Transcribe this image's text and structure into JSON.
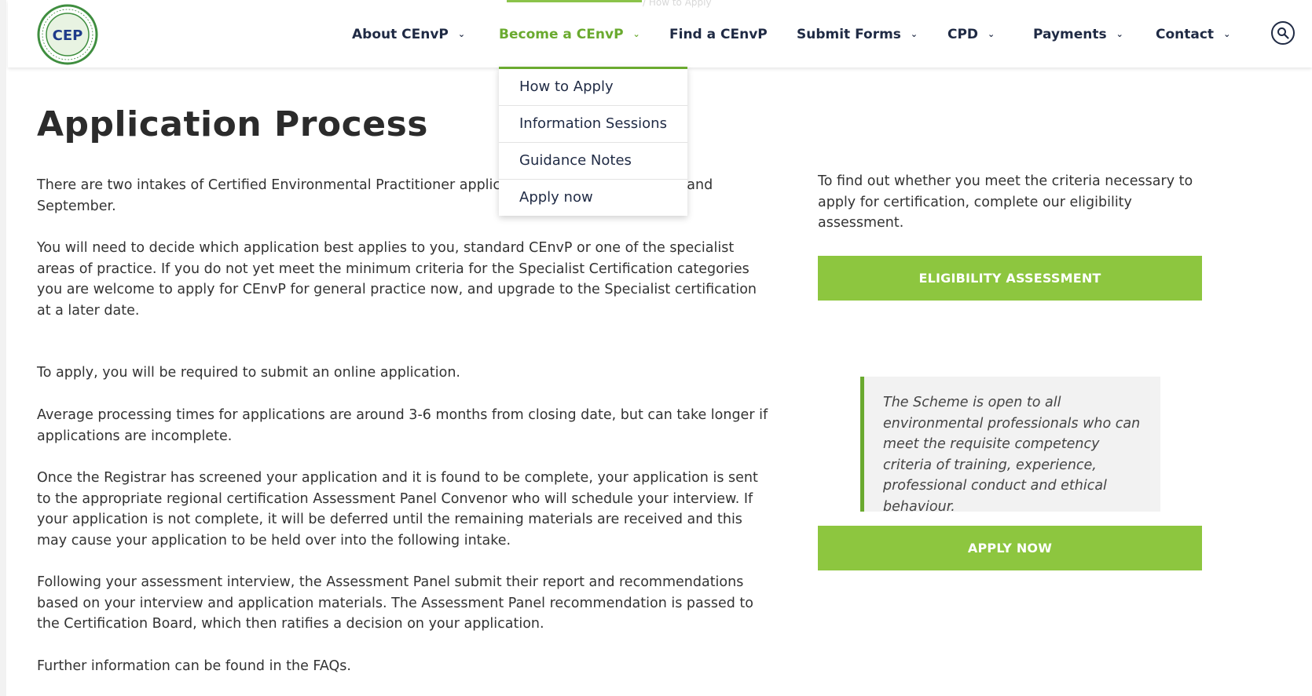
{
  "nav": {
    "items": [
      {
        "label": "About CEnvP",
        "chevron": true
      },
      {
        "label": "Become a CEnvP",
        "chevron": true,
        "active": true
      },
      {
        "label": "Find a CEnvP",
        "chevron": false
      },
      {
        "label": "Submit Forms",
        "chevron": true
      },
      {
        "label": "CPD",
        "chevron": true
      },
      {
        "label": "Payments",
        "chevron": true
      },
      {
        "label": "Contact",
        "chevron": true
      }
    ],
    "faint_breadcrumb": "/ How to Apply"
  },
  "logo": {
    "initials": "CEP",
    "ring_text": "CERTIFIED ENVIRONMENTAL PRACTITIONER"
  },
  "dropdown": {
    "items": [
      "How to Apply",
      "Information Sessions",
      "Guidance Notes",
      "Apply now"
    ]
  },
  "main": {
    "title": "Application Process",
    "paragraphs": [
      "There are two intakes of Certified Environmental Practitioner applications each year, in March and September.",
      "You will need to decide which application best applies to you, standard CEnvP or one of the specialist areas of practice. If you do not yet meet the minimum criteria for the Specialist Certification categories you are welcome to apply for CEnvP for general practice now, and upgrade to the Specialist certification at a later date.",
      "To apply, you will be required to submit an online application.",
      "Average processing times for applications are around 3-6 months from closing date, but can take longer if applications are incomplete.",
      "Once the Registrar has screened your application and it is found to be complete, your application is sent to the appropriate regional certification Assessment Panel Convenor who will schedule your interview. If your application is not complete, it will be deferred until the remaining materials are received and this may cause your application to be held over into the following intake.",
      "Following your assessment interview, the Assessment Panel submit their report and recommendations based on your interview and application materials. The Assessment Panel recommendation is passed to the Certification Board, which then ratifies a decision on your application.",
      "Further information can be found in the FAQs."
    ]
  },
  "sidebar": {
    "eligibility_text": "To find out whether you meet the criteria necessary to apply for certification, complete our eligibility assessment.",
    "eligibility_button": "ELIGIBILITY ASSESSMENT",
    "quote": "The Scheme is open to all environmental professionals who can meet the requisite competency criteria of training, experience, professional conduct and ethical behaviour.",
    "apply_button": "APPLY NOW"
  },
  "colors": {
    "brand_green": "#8dc63f",
    "active_green": "#6aaa2f",
    "nav_navy": "#1f2a44"
  }
}
